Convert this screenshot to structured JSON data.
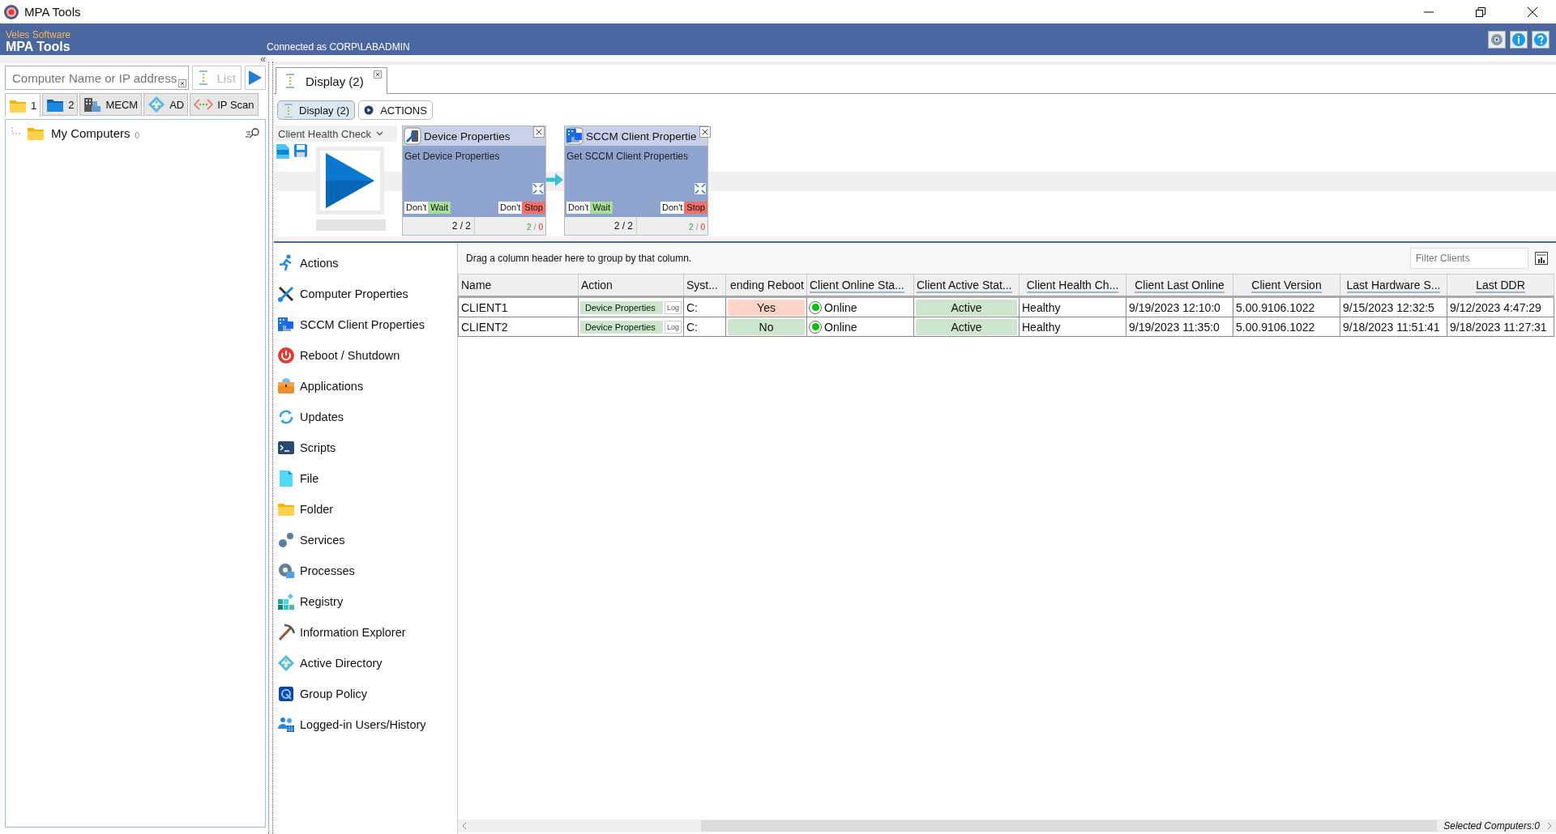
{
  "window": {
    "title": "MPA Tools"
  },
  "header": {
    "vendor": "Veles Software",
    "product": "MPA Tools",
    "connection": "Connected as CORP\\LABADMIN"
  },
  "collapse_glyph": "«",
  "search": {
    "placeholder": "Computer Name or IP address",
    "list_button": "List"
  },
  "source_tabs": [
    {
      "label": "1",
      "selected": true
    },
    {
      "label": "2",
      "selected": false
    },
    {
      "label": "MECM",
      "selected": false
    },
    {
      "label": "AD",
      "selected": false
    },
    {
      "label": "IP Scan",
      "selected": false
    }
  ],
  "tree": [
    {
      "label": "My Computers",
      "count": "0"
    }
  ],
  "document_tabs": [
    {
      "label": "Display (2)",
      "selected": true
    }
  ],
  "view_tabs": [
    {
      "label": "Display (2)",
      "selected": true
    },
    {
      "label": "ACTIONS",
      "selected": false
    }
  ],
  "workflow": {
    "dropdown": "Client Health Check",
    "steps": [
      {
        "title": "Device Properties",
        "description": "Get Device Properties",
        "wait": {
          "negation": "Don't",
          "label": "Wait"
        },
        "stop": {
          "negation": "Don't",
          "label": "Stop"
        },
        "progress": "2 / 2",
        "results": [
          {
            "text": "2",
            "kind": "success"
          },
          {
            "text": "/",
            "kind": "separator"
          },
          {
            "text": "0",
            "kind": "failure"
          }
        ]
      },
      {
        "title": "SCCM Client Propertie",
        "description": "Get SCCM Client Properties",
        "wait": {
          "negation": "Don't",
          "label": "Wait"
        },
        "stop": {
          "negation": "Don't",
          "label": "Stop"
        },
        "progress": "2 / 2",
        "results": [
          {
            "text": "2",
            "kind": "success"
          },
          {
            "text": "/",
            "kind": "separator"
          },
          {
            "text": "0",
            "kind": "failure"
          }
        ]
      }
    ]
  },
  "actions_menu": [
    {
      "label": "Actions"
    },
    {
      "label": "Computer Properties"
    },
    {
      "label": "SCCM Client Properties"
    },
    {
      "label": "Reboot / Shutdown"
    },
    {
      "label": "Applications"
    },
    {
      "label": "Updates"
    },
    {
      "label": "Scripts"
    },
    {
      "label": "File"
    },
    {
      "label": "Folder"
    },
    {
      "label": "Services"
    },
    {
      "label": "Processes"
    },
    {
      "label": "Registry"
    },
    {
      "label": "Information Explorer"
    },
    {
      "label": "Active Directory"
    },
    {
      "label": "Group Policy"
    },
    {
      "label": "Logged-in Users/History"
    }
  ],
  "grid": {
    "group_hint": "Drag a column header here to group by that column.",
    "filter_placeholder": "Filter Clients",
    "columns": [
      {
        "label": "Name",
        "underlined": false
      },
      {
        "label": "Action",
        "underlined": false
      },
      {
        "label": "Syst...",
        "underlined": false
      },
      {
        "label": "ending Reboot",
        "underlined": false
      },
      {
        "label": "Client Online Sta...",
        "underlined": true
      },
      {
        "label": "Client Active Stat...",
        "underlined": true
      },
      {
        "label": "Client Health Ch...",
        "underlined": true
      },
      {
        "label": "Client Last Online",
        "underlined": true
      },
      {
        "label": "Client Version",
        "underlined": true
      },
      {
        "label": "Last Hardware S...",
        "underlined": true
      },
      {
        "label": "Last DDR",
        "underlined": true
      }
    ],
    "rows": [
      {
        "cells": [
          {
            "kind": "text",
            "text": "CLIENT1"
          },
          {
            "kind": "action",
            "text": "Device Properties",
            "button": "Log"
          },
          {
            "kind": "text",
            "text": "C:"
          },
          {
            "kind": "flag",
            "text": "Yes",
            "color": "#fdd5c8"
          },
          {
            "kind": "online",
            "text": "Online",
            "color": "#00c400"
          },
          {
            "kind": "flag",
            "text": "Active",
            "color": "#cde6cd"
          },
          {
            "kind": "text",
            "text": "Healthy"
          },
          {
            "kind": "text",
            "text": "9/19/2023 12:10:0"
          },
          {
            "kind": "text",
            "text": "5.00.9106.1022"
          },
          {
            "kind": "text",
            "text": "9/15/2023 12:32:5"
          },
          {
            "kind": "text",
            "text": "9/12/2023 4:47:29"
          }
        ]
      },
      {
        "cells": [
          {
            "kind": "text",
            "text": "CLIENT2"
          },
          {
            "kind": "action",
            "text": "Device Properties",
            "button": "Log"
          },
          {
            "kind": "text",
            "text": "C:"
          },
          {
            "kind": "flag",
            "text": "No",
            "color": "#cde6cd"
          },
          {
            "kind": "online",
            "text": "Online",
            "color": "#00c400"
          },
          {
            "kind": "flag",
            "text": "Active",
            "color": "#cde6cd"
          },
          {
            "kind": "text",
            "text": "Healthy"
          },
          {
            "kind": "text",
            "text": "9/19/2023 11:35:0"
          },
          {
            "kind": "text",
            "text": "5.00.9106.1022"
          },
          {
            "kind": "text",
            "text": "9/18/2023 11:51:41"
          },
          {
            "kind": "text",
            "text": "9/18/2023 11:27:31"
          }
        ]
      }
    ],
    "status": "Selected Computers:0"
  }
}
